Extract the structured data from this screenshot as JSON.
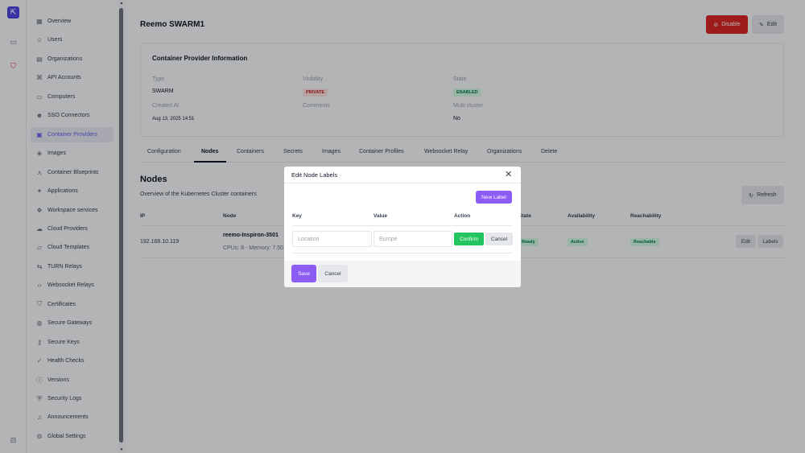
{
  "sidebar": {
    "items": [
      {
        "label": "Overview",
        "icon": "grid-icon"
      },
      {
        "label": "Users",
        "icon": "user-icon"
      },
      {
        "label": "Organizations",
        "icon": "building-icon"
      },
      {
        "label": "API Accounts",
        "icon": "api-icon"
      },
      {
        "label": "Computers",
        "icon": "monitor-icon"
      },
      {
        "label": "SSO Connectors",
        "icon": "users-icon"
      },
      {
        "label": "Container Providers",
        "icon": "server-icon"
      },
      {
        "label": "Images",
        "icon": "layers-icon"
      },
      {
        "label": "Container Blueprints",
        "icon": "blueprint-icon"
      },
      {
        "label": "Applications",
        "icon": "apps-icon"
      },
      {
        "label": "Workspace services",
        "icon": "services-icon"
      },
      {
        "label": "Cloud Providers",
        "icon": "cloud-icon"
      },
      {
        "label": "Cloud Templates",
        "icon": "template-icon"
      },
      {
        "label": "TURN Relays",
        "icon": "relay-icon"
      },
      {
        "label": "Websocket Relays",
        "icon": "code-icon"
      },
      {
        "label": "Certificates",
        "icon": "shield-icon"
      },
      {
        "label": "Secure Gateways",
        "icon": "globe-icon"
      },
      {
        "label": "Secure Keys",
        "icon": "key-icon"
      },
      {
        "label": "Health Checks",
        "icon": "health-icon"
      },
      {
        "label": "Versions",
        "icon": "info-icon"
      },
      {
        "label": "Security Logs",
        "icon": "shield-check-icon"
      },
      {
        "label": "Announcements",
        "icon": "bell-icon"
      },
      {
        "label": "Global Settings",
        "icon": "gear-icon"
      }
    ],
    "active_index": 6
  },
  "header": {
    "title": "Reemo SWARM1",
    "disable_label": "Disable",
    "edit_label": "Edit"
  },
  "info": {
    "heading": "Container Provider Information",
    "type_label": "Type",
    "type_value": "SWARM",
    "visibility_label": "Visibility",
    "visibility_value": "PRIVATE",
    "state_label": "State",
    "state_value": "ENABLED",
    "created_label": "Created At",
    "created_value": "Aug 13, 2025 14:51",
    "comments_label": "Comments",
    "multi_label": "Multi cluster",
    "multi_value": "No"
  },
  "tabs": [
    "Configuration",
    "Nodes",
    "Containers",
    "Secrets",
    "Images",
    "Container Profiles",
    "Websocket Relay",
    "Organizations",
    "Delete"
  ],
  "nodes": {
    "heading": "Nodes",
    "subtitle": "Overview of the Kubernetes Cluster containers",
    "refresh_label": "Refresh",
    "columns": {
      "ip": "IP",
      "node": "Node",
      "state": "State",
      "availability": "Availability",
      "reachability": "Reachability"
    },
    "row": {
      "ip": "192.168.10.119",
      "node": "reemo-Inspiron-3501",
      "specs": "CPUs: 8 - Memory: 7.50",
      "state": "Ready",
      "availability": "Active",
      "reachability": "Reachable",
      "edit_label": "Edit",
      "labels_label": "Labels"
    }
  },
  "modal": {
    "title": "Edit Node Labels",
    "new_label": "New Label",
    "col_key": "Key",
    "col_value": "Value",
    "col_action": "Action",
    "key_value": "Location",
    "value_value": "Europe",
    "confirm_label": "Confirm",
    "row_cancel_label": "Cancel",
    "save_label": "Save",
    "cancel_label": "Cancel"
  },
  "colors": {
    "accent": "#8b5cf6",
    "danger": "#dc2626",
    "success": "#22c55e"
  }
}
